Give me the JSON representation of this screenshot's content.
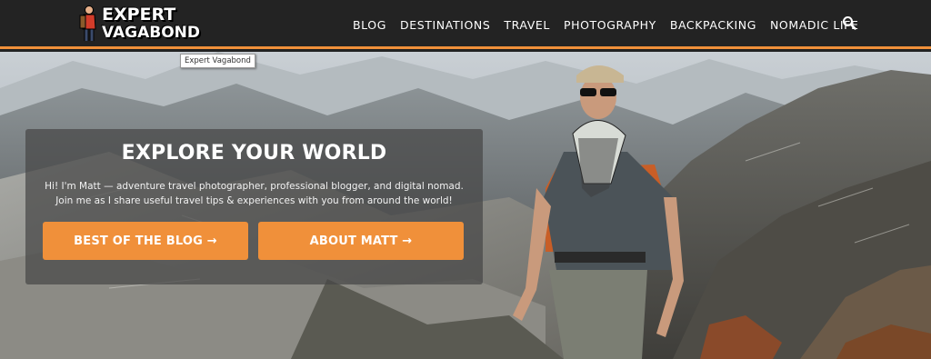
{
  "site": {
    "logo_line1": "EXPERT",
    "logo_line2": "VAGABOND",
    "logo_tooltip": "Expert Vagabond"
  },
  "nav": {
    "items": [
      {
        "label": "BLOG"
      },
      {
        "label": "DESTINATIONS"
      },
      {
        "label": "TRAVEL"
      },
      {
        "label": "PHOTOGRAPHY"
      },
      {
        "label": "BACKPACKING"
      },
      {
        "label": "NOMADIC LIFE"
      }
    ],
    "search_icon": "search-icon"
  },
  "hero": {
    "title": "EXPLORE YOUR WORLD",
    "intro": "Hi! I'm Matt — adventure travel photographer, professional blogger, and digital nomad. Join me as I share useful travel tips & experiences with you from around the world!",
    "button_blog": "BEST OF THE BLOG →",
    "button_about": "ABOUT MATT →"
  },
  "colors": {
    "accent": "#f0903a",
    "header_bg": "#232323"
  }
}
